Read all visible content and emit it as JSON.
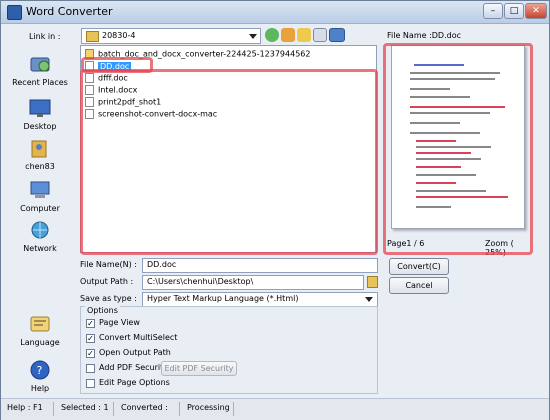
{
  "window": {
    "title": "Word Converter"
  },
  "link_in": {
    "label": "Link in :",
    "path": "20830-4",
    "places": [
      {
        "name": "recent-places",
        "label": "Recent Places",
        "icon": "recent-places-icon"
      },
      {
        "name": "desktop",
        "label": "Desktop",
        "icon": "desktop-icon"
      },
      {
        "name": "chen83",
        "label": "chen83",
        "icon": "user-folder-icon"
      },
      {
        "name": "computer",
        "label": "Computer",
        "icon": "computer-icon"
      },
      {
        "name": "network",
        "label": "Network",
        "icon": "network-icon"
      }
    ]
  },
  "files": [
    "batch_doc_and_docx_converter-224425-1237944562",
    "DD.doc",
    "dfff.doc",
    "Intel.docx",
    "print2pdf_shot1",
    "screenshot-convert-docx-mac"
  ],
  "selected_file_index": 1,
  "preview": {
    "file_name_label": "File Name :DD.doc",
    "page_indicator": "Page1 / 6",
    "zoom": "Zoom ( 25%)"
  },
  "form": {
    "file_name_label": "File Name(N) :",
    "file_name_value": "DD.doc",
    "output_path_label": "Output Path :",
    "output_path_value": "C:\\Users\\chenhui\\Desktop\\",
    "save_as_label": "Save as type :",
    "save_as_value": "Hyper Text Markup Language (*.Html)"
  },
  "buttons": {
    "convert": "Convert(C)",
    "cancel": "Cancel",
    "edit_pdf_security": "Edit PDF Security"
  },
  "options": {
    "title": "Options",
    "items": [
      {
        "label": "Page View",
        "checked": true
      },
      {
        "label": "Convert MultiSelect",
        "checked": true
      },
      {
        "label": "Open Output Path",
        "checked": true
      },
      {
        "label": "Add PDF Security",
        "checked": false
      },
      {
        "label": "Edit Page Options",
        "checked": false
      }
    ]
  },
  "tools": [
    {
      "label": "Language",
      "icon": "language-icon"
    },
    {
      "label": "Help",
      "icon": "help-icon"
    }
  ],
  "status": {
    "help": "Help : F1",
    "selected": "Selected : 1",
    "converted": "Converted :",
    "processing": "Processing :"
  },
  "colors": {
    "highlight": "#e64650",
    "selection": "#3399ff"
  }
}
